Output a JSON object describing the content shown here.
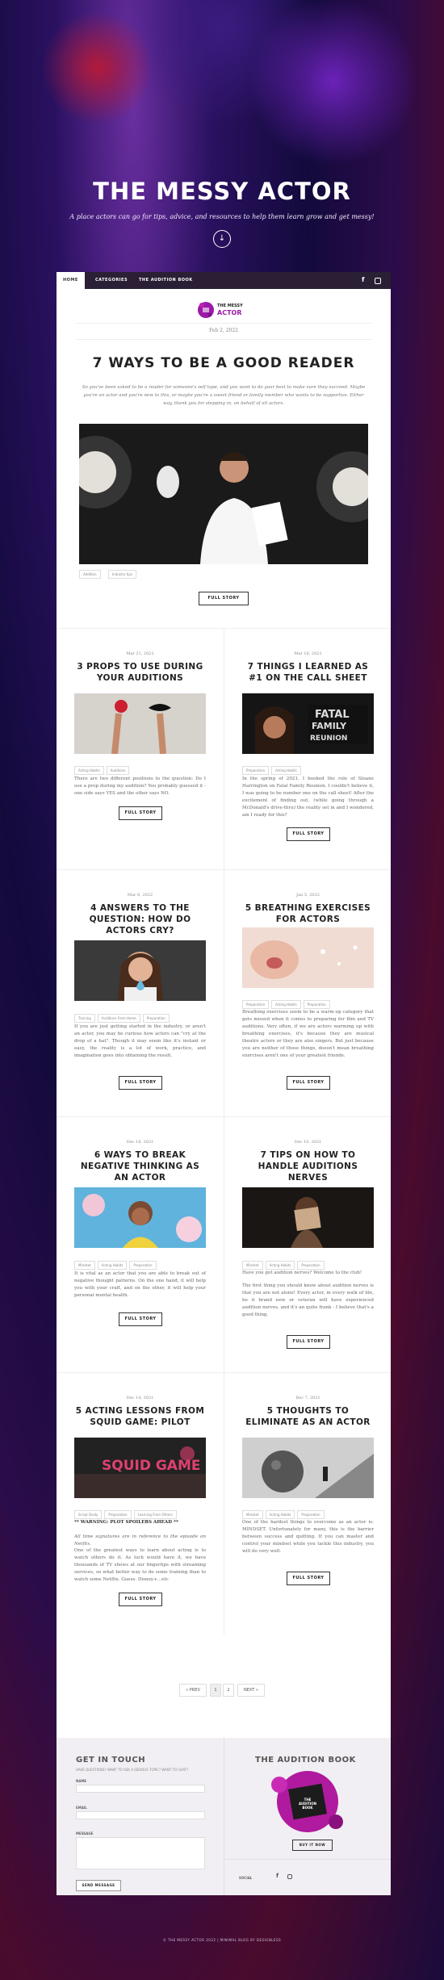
{
  "site": {
    "title": "THE MESSY ACTOR",
    "tagline": "A place actors can go for tips, advice, and resources to help them learn grow and get messy!",
    "down_icon": "chevron-down-icon"
  },
  "nav": {
    "items": [
      "HOME",
      "CATEGORIES",
      "THE AUDITION BOOK"
    ],
    "social": [
      "facebook-icon",
      "instagram-icon"
    ]
  },
  "logo": {
    "line1": "THE MESSY",
    "line2": "ACTOR"
  },
  "featured": {
    "date": "Feb 2, 2022",
    "title": "7 WAYS TO BE A GOOD READER",
    "excerpt": "So you've been asked to be a reader for someone's self tape, and you want to do your best to make sure they succeed. Maybe you're an actor and you're new to this, or maybe you're a sweet friend or family member who wants to be supportive. Either way, thank you for stepping in, on behalf of all actors.",
    "tags": [
      "Addition",
      "Industry tips"
    ],
    "button": "FULL STORY"
  },
  "posts": [
    {
      "date": "Mar 21, 2022",
      "title": "3 PROPS TO USE DURING YOUR AUDITIONS",
      "tags": [
        "Acting Habits",
        "Auditions"
      ],
      "text": [
        "There are two different positions to the question: Do I use a prop during my audition? You probably guessed it - one side says YES and the other says NO."
      ],
      "button": "FULL STORY"
    },
    {
      "date": "Mar 16, 2022",
      "title": "7 THINGS I LEARNED AS #1 ON THE CALL SHEET",
      "tags": [
        "Preparation",
        "Acting Habits"
      ],
      "text": [
        "In the spring of 2021, I booked the role of Sloane Harrington on Fatal Family Reunion. I couldn't believe it, I was going to be number one on the call sheet! After the excitement of finding out, (while going through a McDonald's drive-thru) the reality set in and I wondered, am I ready for this?"
      ],
      "button": "FULL STORY"
    },
    {
      "date": "Mar 8, 2022",
      "title": "4 ANSWERS TO THE QUESTION: HOW DO ACTORS CRY?",
      "tags": [
        "Training",
        "Auditions From Home",
        "Preparation"
      ],
      "text": [
        "If you are just getting started in the industry, or aren't an actor, you may be curious how actors can \"cry at the drop of a hat\". Though it may seem like it's instant or easy, the reality is a lot of work, practice, and imagination goes into obtaining the result."
      ],
      "button": "FULL STORY"
    },
    {
      "date": "Jan 5, 2022",
      "title": "5 BREATHING EXERCISES FOR ACTORS",
      "tags": [
        "Preparation",
        "Acting Habits",
        "Preparation"
      ],
      "text": [
        "Breathing exercises seem to be a warm-up category that gets missed when it comes to preparing for film and TV auditions. Very often, if we are actors warming up with breathing exercises, it's because they are musical theatre actors or they are also singers. But just because you are neither of those things, doesn't mean breathing exercises aren't one of your greatest friends."
      ],
      "button": "FULL STORY"
    },
    {
      "date": "Dec 18, 2021",
      "title": "6 WAYS TO BREAK NEGATIVE THINKING AS AN ACTOR",
      "tags": [
        "Mindset",
        "Acting Habits",
        "Preparation"
      ],
      "text": [
        "It is vital as an actor that you are able to break out of negative thought patterns. On the one hand, it will help you with your craft, and on the other, it will help your personal mental health."
      ],
      "button": "FULL STORY"
    },
    {
      "date": "Dec 10, 2021",
      "title": "7 TIPS ON HOW TO HANDLE AUDITIONS NERVES",
      "tags": [
        "Mindset",
        "Acting Habits",
        "Preparation"
      ],
      "text": [
        "Have you got audition nerves? Welcome to the club!",
        "The first thing you should know about audition nerves is that you are not alone! Every actor, in every walk of life, be it brand new or veteran will have experienced audition nerves, and it's an quite frank - I believe that's a good thing."
      ],
      "button": "FULL STORY"
    },
    {
      "date": "Dec 14, 2021",
      "title": "5 ACTING LESSONS FROM SQUID GAME: PILOT",
      "tags": [
        "Script Study",
        "Preparation",
        "Learning From Others"
      ],
      "text": [
        "** WARNING: PLOT SPOILERS AHEAD **",
        "All time signatures are in reference to the episode on Netflix.",
        "One of the greatest ways to learn about acting is to watch others do it. As luck would have it, we have thousands of TV shows at our fingertips with streaming services, so what better way to do some training than to watch some Netflix. Guess. Disney+...etc"
      ],
      "button": "FULL STORY"
    },
    {
      "date": "Dec 7, 2021",
      "title": "5 THOUGHTS TO ELIMINATE AS AN ACTOR",
      "tags": [
        "Mindset",
        "Acting Habits",
        "Preparation"
      ],
      "text": [
        "One of the hardest things to overcome as an actor is: MINDSET. Unfortunately for many, this is the barrier between success and quitting. If you can master and control your mindset while you tackle this industry, you will do very well."
      ],
      "button": "FULL STORY"
    }
  ],
  "pagination": {
    "prev": "« PREV",
    "pages": [
      "1",
      "2"
    ],
    "next": "NEXT »"
  },
  "footer": {
    "contact_title": "GET IN TOUCH",
    "contact_sub": "HAVE QUESTIONS? WANT TO ASK A SERIOUS TOPIC? WANT TO CHAT?",
    "name_label": "NAME",
    "email_label": "EMAIL",
    "message_label": "MESSAGE",
    "send_button": "SEND MESSAGE",
    "book_title": "THE AUDITION BOOK",
    "book_cover_text": "THE AUDITION BOOK",
    "buy_button": "BUY IT NOW",
    "social_label": "SOCIAL"
  },
  "copyright": "© THE MESSY ACTOR 2022  |  MINIMAL BLOG BY DESIGNLESS",
  "colors": {
    "accent": "#9b1aa8",
    "nav": "#2a1f34"
  }
}
